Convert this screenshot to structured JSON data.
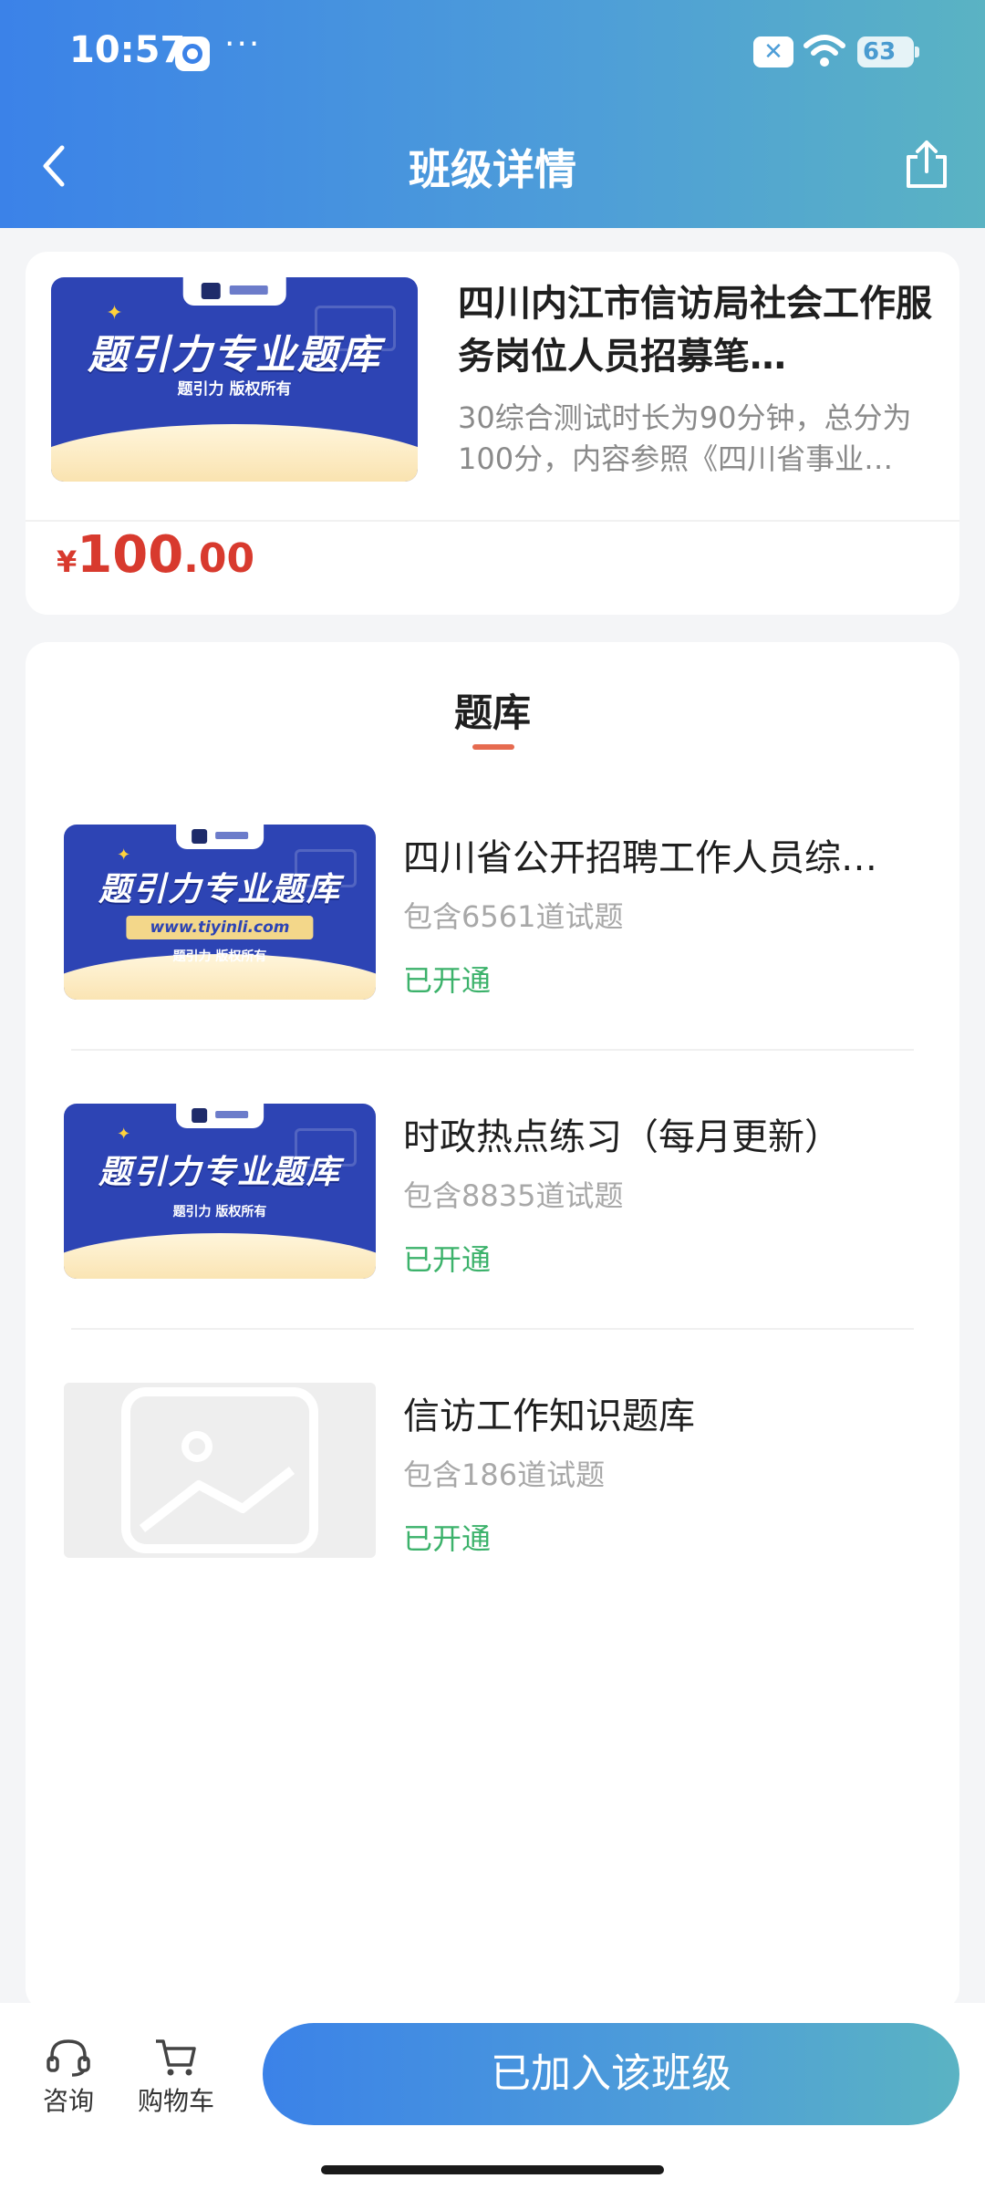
{
  "status_bar": {
    "time": "10:57",
    "dots": "···",
    "battery": "63"
  },
  "header": {
    "title": "班级详情",
    "back_icon": "chevron-left-icon",
    "share_icon": "share-icon"
  },
  "class_info": {
    "cover_headline": "题引力专业题库",
    "cover_copyright": "题引力 版权所有",
    "title": "四川内江市信访局社会工作服务岗位人员招募笔…",
    "description": "30综合测试时长为90分钟，总分为100分，内容参照《四川省事业…",
    "price_currency": "¥",
    "price_integer": "100",
    "price_decimal": ".00"
  },
  "question_bank": {
    "tab_label": "题库",
    "items": [
      {
        "name": "四川省公开招聘工作人员综…",
        "count": "包含6561道试题",
        "status": "已开通",
        "cover_headline": "题引力专业题库",
        "cover_url": "www.tiyinli.com",
        "cover_copyright": "题引力 版权所有"
      },
      {
        "name": "时政热点练习（每月更新）",
        "count": "包含8835道试题",
        "status": "已开通",
        "cover_headline": "题引力专业题库",
        "cover_copyright": "题引力 版权所有"
      },
      {
        "name": "信访工作知识题库",
        "count": "包含186道试题",
        "status": "已开通"
      }
    ]
  },
  "bottom_bar": {
    "consult_label": "咨询",
    "cart_label": "购物车",
    "join_label": "已加入该班级"
  },
  "colors": {
    "header_gradient_start": "#3b82e8",
    "header_gradient_end": "#5ab3c3",
    "price_red": "#d83a2e",
    "status_green": "#3cb26b",
    "tab_underline": "#e66b50"
  }
}
